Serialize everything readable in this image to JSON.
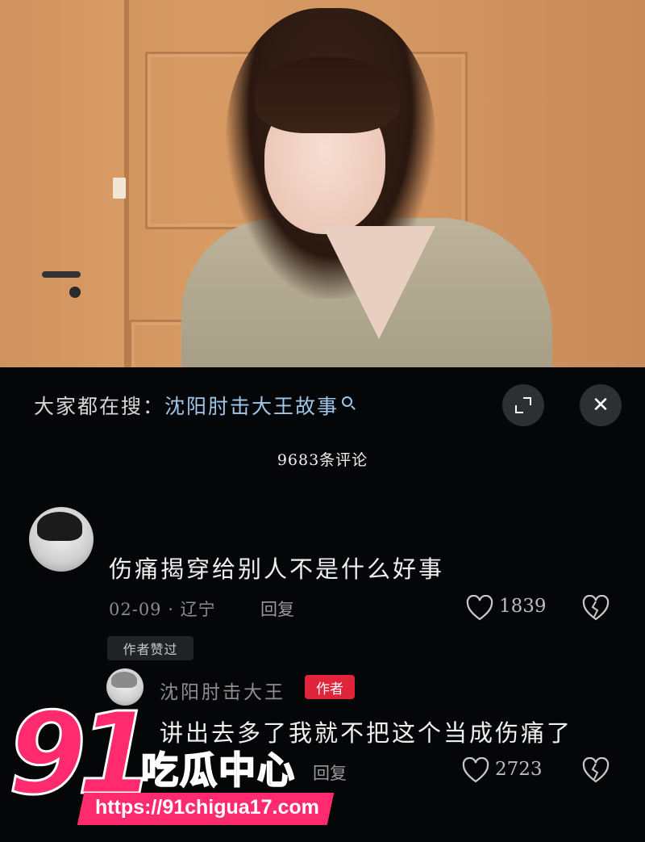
{
  "search": {
    "label": "大家都在搜：",
    "term": "沈阳肘击大王故事"
  },
  "comments_header": {
    "count_text": "9683条评论"
  },
  "comments": [
    {
      "text": "伤痛揭穿给别人不是什么好事",
      "meta": "02-09 · 辽宁",
      "reply_label": "回复",
      "likes": "1839",
      "tag": "作者赞过"
    }
  ],
  "reply": {
    "username": "沈阳肘击大王",
    "badge": "作者",
    "text": "讲出去多了我就不把这个当成伤痛了",
    "reply_label": "回复",
    "likes": "2723"
  },
  "watermark": {
    "number": "91",
    "name": "吃瓜中心",
    "url": "https://91chigua17.com"
  },
  "colors": {
    "accent_blue": "#9ec7ea",
    "badge_red": "#e0243a",
    "watermark_pink": "#ff2b6e",
    "background": "#050607"
  }
}
